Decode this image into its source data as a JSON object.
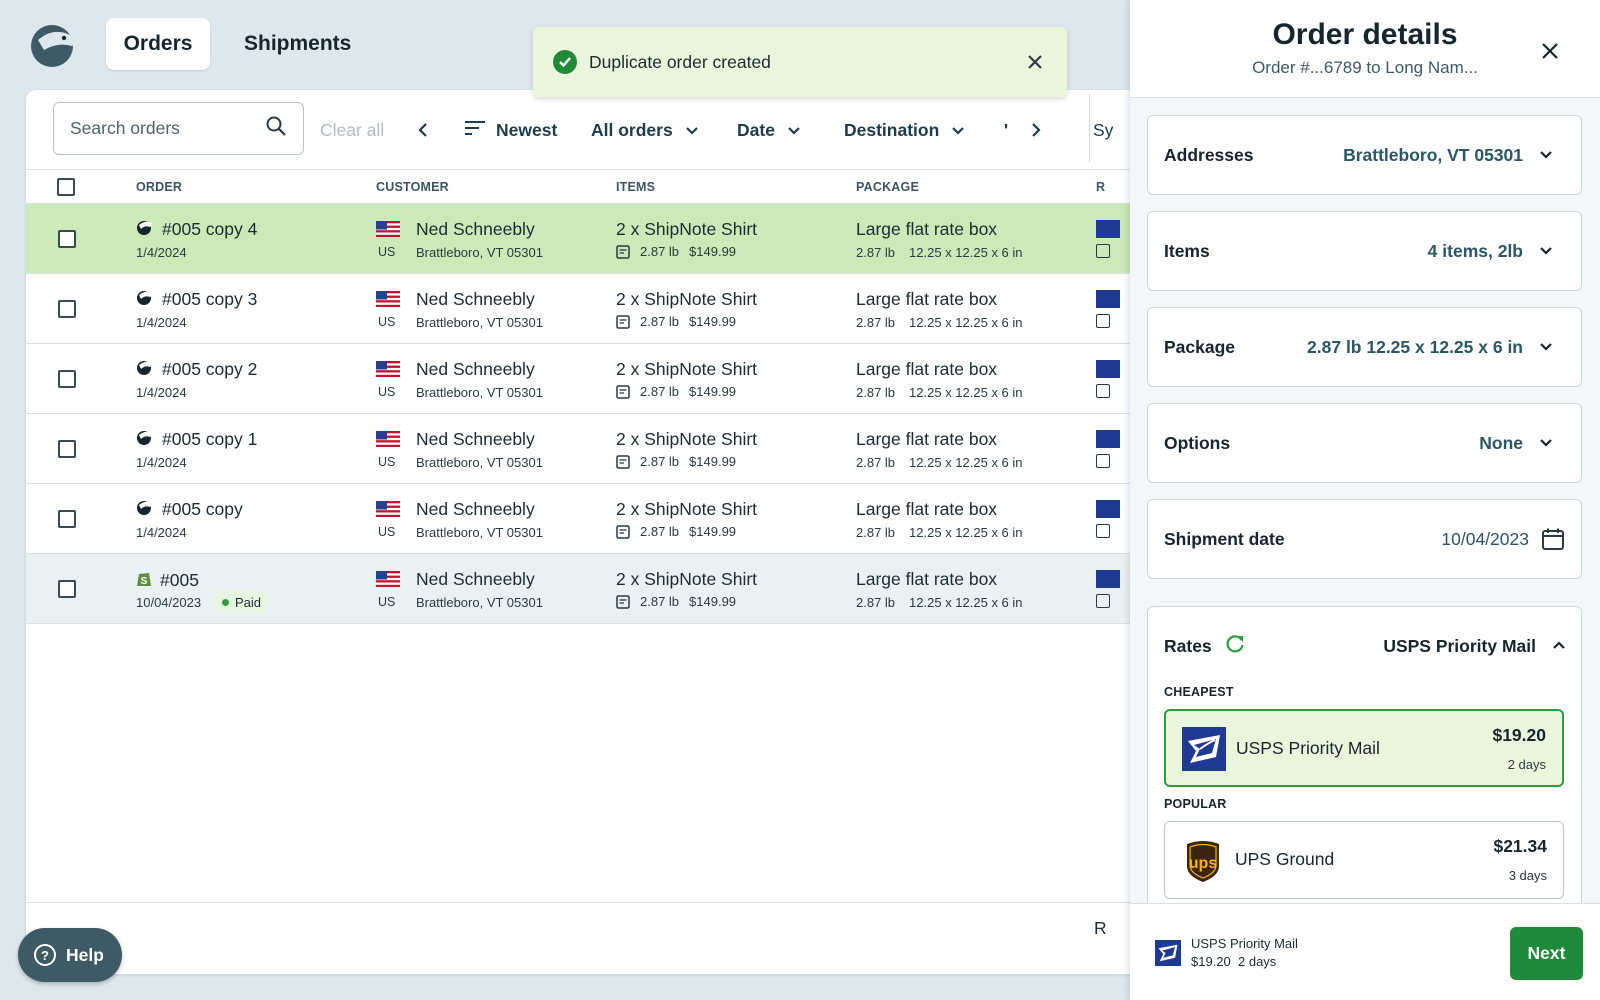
{
  "nav": {
    "tabs": [
      {
        "label": "Orders"
      },
      {
        "label": "Shipments"
      }
    ]
  },
  "toast": {
    "message": "Duplicate order created"
  },
  "toolbar": {
    "search_placeholder": "Search orders",
    "clear_all": "Clear all",
    "sort": "Newest",
    "filter_orders": "All orders",
    "filter_date": "Date",
    "filter_destination": "Destination",
    "overflow_text": "Sy"
  },
  "table": {
    "headers": [
      "ORDER",
      "CUSTOMER",
      "ITEMS",
      "PACKAGE",
      "R"
    ],
    "rows": [
      {
        "order": "#005 copy 4",
        "date": "1/4/2024",
        "country": "US",
        "customer": "Ned Schneebly",
        "address": "Brattleboro, VT 05301",
        "item": "2 x  ShipNote Shirt",
        "item_weight": "2.87 lb",
        "item_price": "$149.99",
        "package": "Large flat rate box",
        "pkg_weight": "2.87 lb",
        "pkg_dims": "12.25 x 12.25 x 6 in"
      },
      {
        "order": "#005 copy 3",
        "date": "1/4/2024",
        "country": "US",
        "customer": "Ned Schneebly",
        "address": "Brattleboro, VT 05301",
        "item": "2 x  ShipNote Shirt",
        "item_weight": "2.87 lb",
        "item_price": "$149.99",
        "package": "Large flat rate box",
        "pkg_weight": "2.87 lb",
        "pkg_dims": "12.25 x 12.25 x 6 in"
      },
      {
        "order": "#005 copy 2",
        "date": "1/4/2024",
        "country": "US",
        "customer": "Ned Schneebly",
        "address": "Brattleboro, VT 05301",
        "item": "2 x  ShipNote Shirt",
        "item_weight": "2.87 lb",
        "item_price": "$149.99",
        "package": "Large flat rate box",
        "pkg_weight": "2.87 lb",
        "pkg_dims": "12.25 x 12.25 x 6 in"
      },
      {
        "order": "#005 copy 1",
        "date": "1/4/2024",
        "country": "US",
        "customer": "Ned Schneebly",
        "address": "Brattleboro, VT 05301",
        "item": "2 x  ShipNote Shirt",
        "item_weight": "2.87 lb",
        "item_price": "$149.99",
        "package": "Large flat rate box",
        "pkg_weight": "2.87 lb",
        "pkg_dims": "12.25 x 12.25 x 6 in"
      },
      {
        "order": "#005 copy",
        "date": "1/4/2024",
        "country": "US",
        "customer": "Ned Schneebly",
        "address": "Brattleboro, VT 05301",
        "item": "2 x  ShipNote Shirt",
        "item_weight": "2.87 lb",
        "item_price": "$149.99",
        "package": "Large flat rate box",
        "pkg_weight": "2.87 lb",
        "pkg_dims": "12.25 x 12.25 x 6 in"
      },
      {
        "order": "#005",
        "date": "10/04/2023",
        "badge": "Paid",
        "country": "US",
        "customer": "Ned Schneebly",
        "address": "Brattleboro, VT 05301",
        "item": "2 x  ShipNote Shirt",
        "item_weight": "2.87 lb",
        "item_price": "$149.99",
        "package": "Large flat rate box",
        "pkg_weight": "2.87 lb",
        "pkg_dims": "12.25 x 12.25 x 6 in"
      }
    ],
    "footer_text": "R"
  },
  "help": {
    "label": "Help"
  },
  "panel": {
    "title": "Order details",
    "subtitle": "Order #...6789 to Long Nam...",
    "sections": [
      {
        "label": "Addresses",
        "value": "Brattleboro, VT 05301"
      },
      {
        "label": "Items",
        "value": "4 items, 2lb"
      },
      {
        "label": "Package",
        "value": "2.87 lb 12.25 x 12.25 x 6 in"
      },
      {
        "label": "Options",
        "value": "None"
      },
      {
        "label": "Shipment date",
        "value": "10/04/2023"
      }
    ],
    "rates": {
      "label": "Rates",
      "selected": "USPS Priority Mail",
      "groups": [
        {
          "title": "CHEAPEST",
          "carrier": "USPS Priority Mail",
          "price": "$19.20",
          "days": "2 days"
        },
        {
          "title": "POPULAR",
          "carrier": "UPS Ground",
          "price": "$21.34",
          "days": "3 days"
        }
      ]
    },
    "footer": {
      "carrier": "USPS Priority Mail",
      "price": "$19.20",
      "days": "2 days",
      "next_label": "Next"
    }
  },
  "colors": {
    "accent_green": "#1f8b3a",
    "selected_row": "#cbeab7",
    "toast_bg": "#e9f6dc",
    "usps_blue": "#1f3a93",
    "ups_brown": "#3b2412",
    "ups_gold": "#f7b500"
  },
  "icons": [
    "mole-logo-icon",
    "check-circle-icon",
    "close-icon",
    "search-icon",
    "chevron-left-icon",
    "chevron-right-icon",
    "sort-icon",
    "chevron-down-icon",
    "chevron-up-icon",
    "us-flag-icon",
    "note-icon",
    "shopify-icon",
    "calendar-icon",
    "refresh-icon",
    "usps-logo-icon",
    "ups-logo-icon",
    "help-icon"
  ]
}
